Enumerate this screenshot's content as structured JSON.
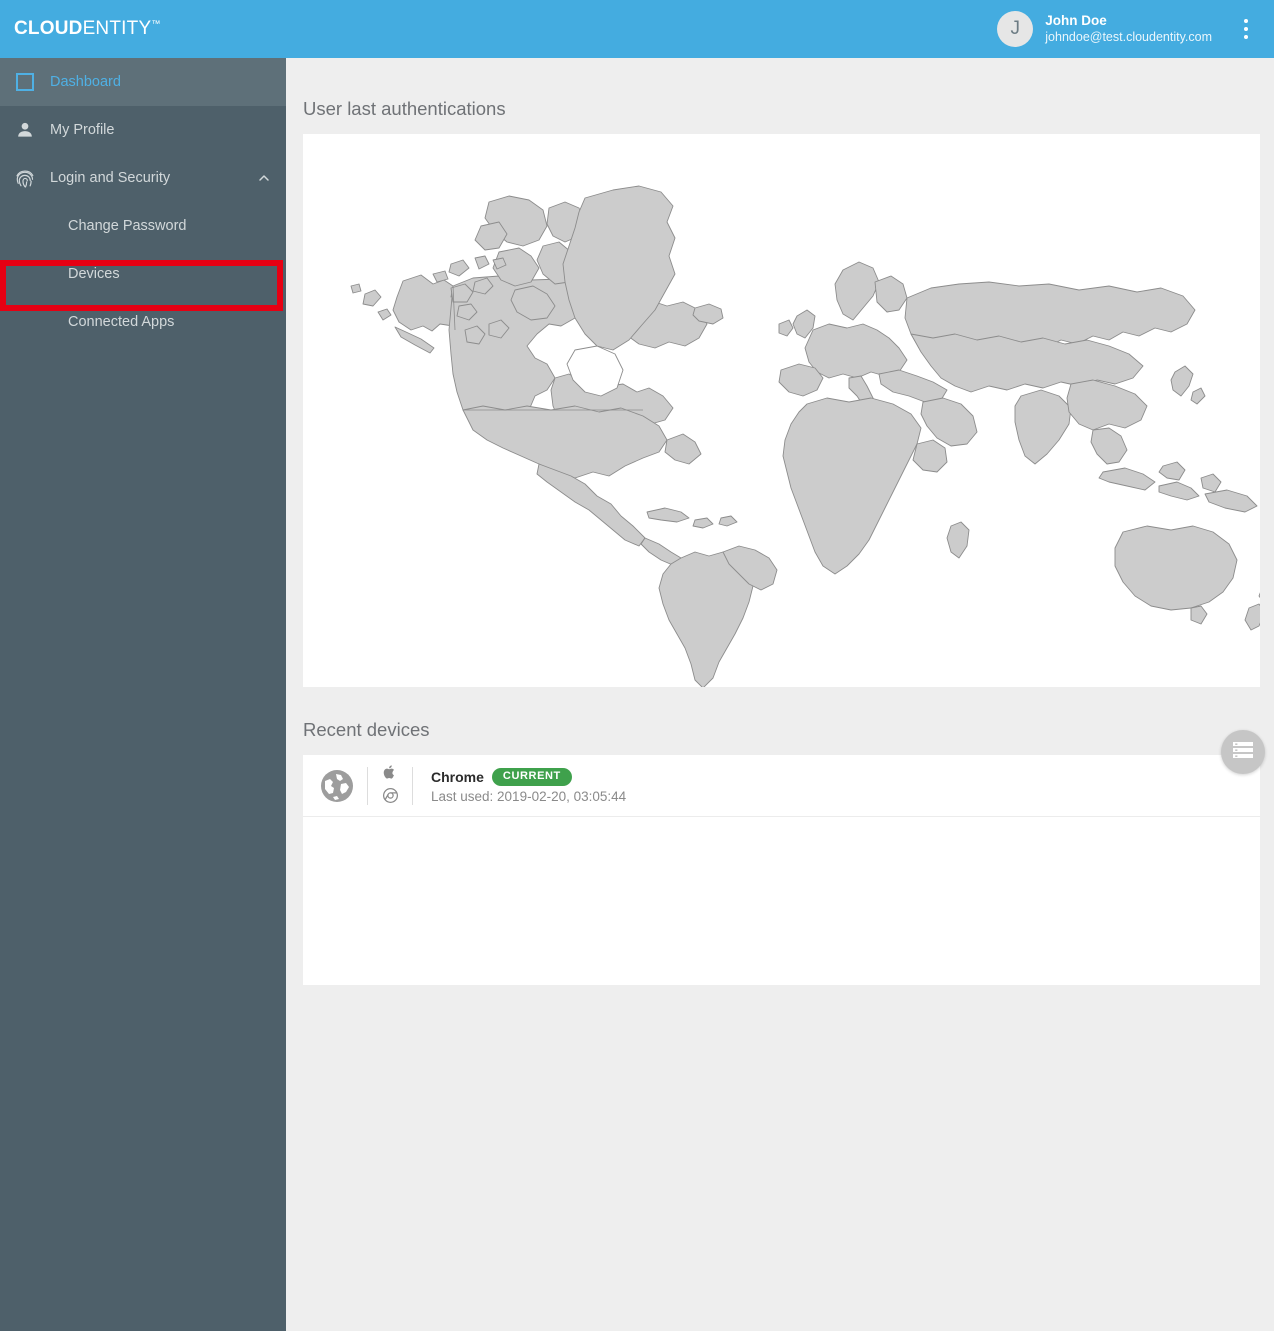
{
  "brand": {
    "name_bold": "CLOUD",
    "name_light": "ENTITY",
    "trademark": "™"
  },
  "topbar": {
    "avatar_initial": "J",
    "user_name": "John Doe",
    "user_email": "johndoe@test.cloudentity.com",
    "menu_icon": "kebab-menu-icon",
    "background_color": "#44ace0"
  },
  "sidebar": {
    "background_color": "#4e606a",
    "active_background_color": "#5e7079",
    "active_text_color": "#4fb0e4",
    "items": [
      {
        "label": "Dashboard",
        "icon": "dashboard-square-icon",
        "active": true
      },
      {
        "label": "My Profile",
        "icon": "person-icon",
        "active": false
      },
      {
        "label": "Login and Security",
        "icon": "fingerprint-icon",
        "active": false,
        "expanded": true,
        "chevron": "chevron-up-icon"
      }
    ],
    "sub_items": [
      {
        "label": "Change Password",
        "highlighted": true
      },
      {
        "label": "Devices",
        "highlighted": false
      },
      {
        "label": "Connected Apps",
        "highlighted": false
      }
    ],
    "annotation_color": "#e60013"
  },
  "main": {
    "map_section_title": "User last authentications",
    "devices_section_title": "Recent devices",
    "map": {
      "land_color": "#cccccc",
      "border_color": "#8c8c8c",
      "ocean_color": "#ffffff"
    },
    "devices": [
      {
        "browser_icon": "globe-icon",
        "os_icon": "apple-icon",
        "app_icon": "chrome-icon",
        "name": "Chrome",
        "badge": "CURRENT",
        "badge_color": "#3fa14c",
        "last_used": "Last used: 2019-02-20, 03:05:44"
      }
    ],
    "fab": {
      "icon": "list-records-icon",
      "color": "#c6c6c6"
    }
  }
}
